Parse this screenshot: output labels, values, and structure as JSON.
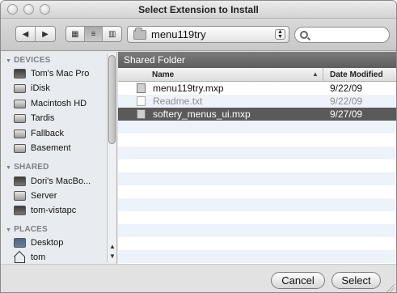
{
  "window": {
    "title": "Select Extension to Install"
  },
  "toolbar": {
    "back_label": "◀",
    "forward_label": "▶",
    "view_icon_label": "▦",
    "view_list_label": "≡",
    "view_column_label": "▥",
    "location": "menu119try",
    "search_placeholder": ""
  },
  "sidebar": {
    "sections": [
      {
        "title": "DEVICES",
        "items": [
          {
            "label": "Tom's Mac Pro",
            "icon": "computer-icon"
          },
          {
            "label": "iDisk",
            "icon": "idisk-icon"
          },
          {
            "label": "Macintosh HD",
            "icon": "hard-drive-icon"
          },
          {
            "label": "Tardis",
            "icon": "hard-drive-icon"
          },
          {
            "label": "Fallback",
            "icon": "hard-drive-icon"
          },
          {
            "label": "Basement",
            "icon": "hard-drive-icon"
          }
        ]
      },
      {
        "title": "SHARED",
        "items": [
          {
            "label": "Dori's MacBo...",
            "icon": "laptop-icon"
          },
          {
            "label": "Server",
            "icon": "server-icon"
          },
          {
            "label": "tom-vistapc",
            "icon": "pc-icon"
          }
        ]
      },
      {
        "title": "PLACES",
        "items": [
          {
            "label": "Desktop",
            "icon": "desktop-icon"
          },
          {
            "label": "tom",
            "icon": "home-icon"
          }
        ]
      }
    ]
  },
  "file_list": {
    "header": "Shared Folder",
    "columns": {
      "name": "Name",
      "date": "Date Modified"
    },
    "rows": [
      {
        "name": "menu119try.mxp",
        "date": "9/22/09",
        "enabled": true,
        "selected": false,
        "icon": "mxp-file-icon"
      },
      {
        "name": "Readme.txt",
        "date": "9/22/09",
        "enabled": false,
        "selected": false,
        "icon": "text-file-icon"
      },
      {
        "name": "softery_menus_ui.mxp",
        "date": "9/27/09",
        "enabled": true,
        "selected": true,
        "icon": "mxp-file-icon"
      }
    ]
  },
  "buttons": {
    "cancel": "Cancel",
    "select": "Select"
  }
}
